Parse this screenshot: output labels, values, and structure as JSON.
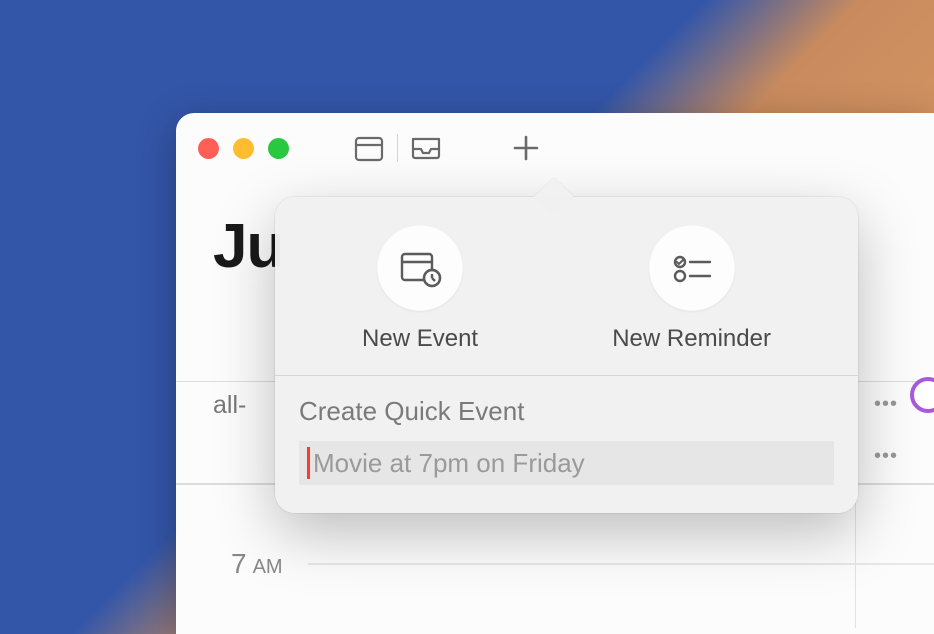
{
  "titlebar": {
    "traffic": {
      "close": "close",
      "minimize": "minimize",
      "zoom": "zoom"
    }
  },
  "header": {
    "month_partial": "Ju"
  },
  "grid": {
    "allday_label": "all-",
    "hour": {
      "num": "7",
      "ampm": "AM"
    }
  },
  "popover": {
    "new_event_label": "New Event",
    "new_reminder_label": "New Reminder",
    "quick_event_label": "Create Quick Event",
    "quick_event_placeholder": "Movie at 7pm on Friday",
    "quick_event_value": ""
  }
}
